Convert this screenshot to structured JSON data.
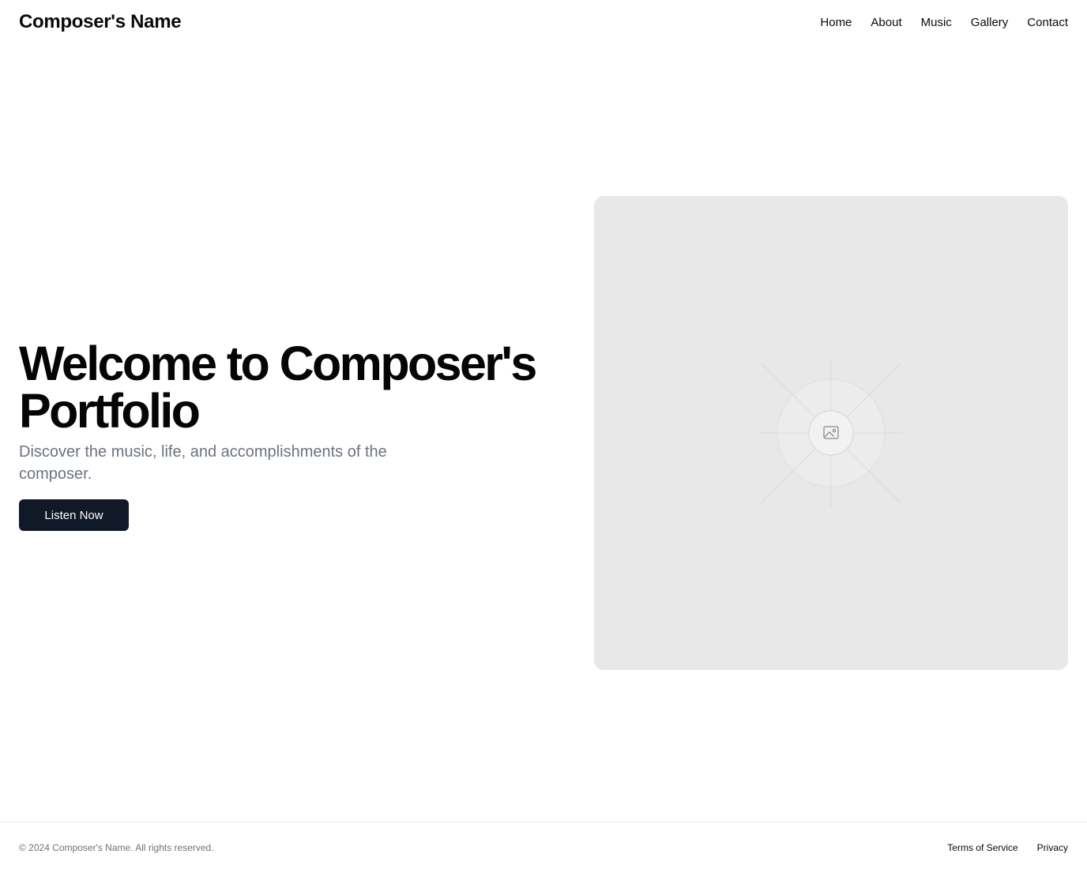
{
  "header": {
    "brand": "Composer's Name",
    "nav": [
      {
        "label": "Home"
      },
      {
        "label": "About"
      },
      {
        "label": "Music"
      },
      {
        "label": "Gallery"
      },
      {
        "label": "Contact"
      }
    ]
  },
  "hero": {
    "title": "Welcome to Composer's Portfolio",
    "subtitle": "Discover the music, life, and accomplishments of the composer.",
    "cta_label": "Listen Now",
    "image_icon": "image-placeholder-icon"
  },
  "footer": {
    "copyright": "© 2024 Composer's Name. All rights reserved.",
    "links": [
      {
        "label": "Terms of Service"
      },
      {
        "label": "Privacy"
      }
    ]
  },
  "colors": {
    "button_bg": "#111827",
    "subtitle": "#6b7280",
    "placeholder_bg": "#e8e8e8"
  }
}
